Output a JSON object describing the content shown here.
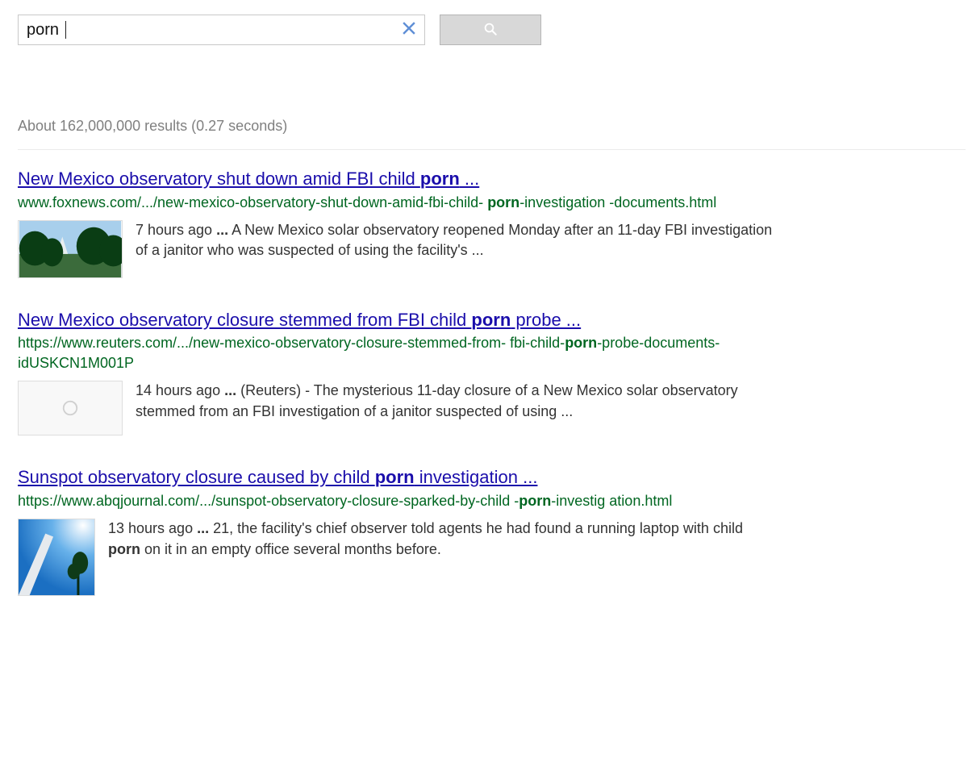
{
  "search": {
    "query": "porn",
    "placeholder": ""
  },
  "stats": "About 162,000,000 results (0.27 seconds)",
  "results": [
    {
      "title_pre": "New Mexico observatory shut down amid FBI child ",
      "title_bold": "porn",
      "title_post": " ...",
      "url_pre": "www.foxnews.com/.../new-mexico-observatory-shut-down-amid-fbi-child- ",
      "url_bold": "porn",
      "url_post": "-investigation -documents.html",
      "snippet": [
        {
          "t": "7 hours ago "
        },
        {
          "t": "...",
          "cls": "ell"
        },
        {
          "t": " A New Mexico solar observatory reopened Monday after an 11-day FBI investigation of a janitor who was suspected of using the facility's ..."
        }
      ]
    },
    {
      "title_pre": "New Mexico observatory closure stemmed from FBI child ",
      "title_bold": "porn",
      "title_post": " probe ...",
      "url_pre": "https://www.reuters.com/.../new-mexico-observatory-closure-stemmed-from- fbi-child-",
      "url_bold": "porn",
      "url_post": "-probe-documents-idUSKCN1M001P",
      "snippet": [
        {
          "t": "14 hours ago "
        },
        {
          "t": "...",
          "cls": "ell"
        },
        {
          "t": " (Reuters) - The mysterious 11-day closure of a New Mexico solar observatory stemmed from an FBI investigation of a janitor suspected of using ..."
        }
      ]
    },
    {
      "title_pre": "Sunspot observatory closure caused by child ",
      "title_bold": "porn",
      "title_post": " investigation ...",
      "url_pre": "https://www.abqjournal.com/.../sunspot-observatory-closure-sparked-by-child -",
      "url_bold": "porn",
      "url_post": "-investig ation.html",
      "snippet": [
        {
          "t": "13 hours ago "
        },
        {
          "t": "...",
          "cls": "ell"
        },
        {
          "t": " 21, the facility's chief observer told agents he had found a running laptop with child "
        },
        {
          "t": "porn",
          "b": true
        },
        {
          "t": " on it in an empty office several months before."
        }
      ]
    }
  ]
}
